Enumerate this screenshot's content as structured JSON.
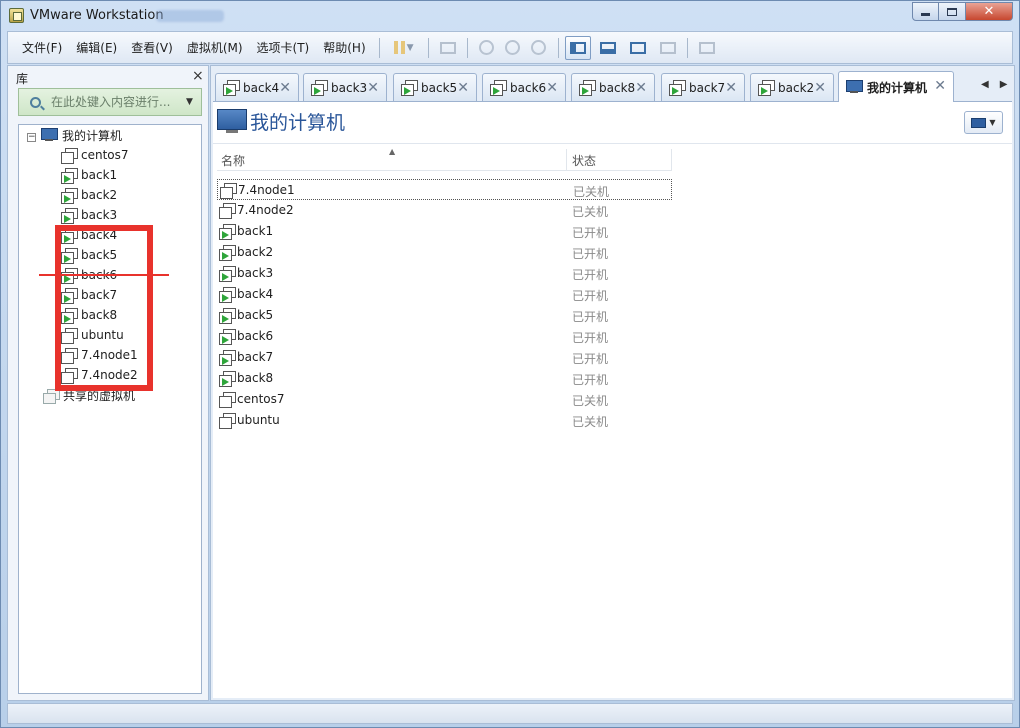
{
  "window": {
    "title": "VMware Workstation"
  },
  "menu": [
    {
      "id": "file",
      "label": "文件(F)"
    },
    {
      "id": "edit",
      "label": "编辑(E)"
    },
    {
      "id": "view",
      "label": "查看(V)"
    },
    {
      "id": "vm",
      "label": "虚拟机(M)"
    },
    {
      "id": "tabs",
      "label": "选项卡(T)"
    },
    {
      "id": "help",
      "label": "帮助(H)"
    }
  ],
  "library": {
    "title": "库",
    "search_placeholder": "在此处键入内容进行...",
    "root": "我的计算机",
    "items": [
      "centos7",
      "back1",
      "back2",
      "back3",
      "back4",
      "back5",
      "back6",
      "back7",
      "back8",
      "ubuntu",
      "7.4node1",
      "7.4node2"
    ],
    "shared": "共享的虚拟机"
  },
  "tabs": [
    {
      "label": "back4",
      "active": false
    },
    {
      "label": "back3",
      "active": false
    },
    {
      "label": "back5",
      "active": false
    },
    {
      "label": "back6",
      "active": false
    },
    {
      "label": "back8",
      "active": false
    },
    {
      "label": "back7",
      "active": false
    },
    {
      "label": "back2",
      "active": false
    },
    {
      "label": "我的计算机",
      "active": true
    }
  ],
  "main": {
    "title": "我的计算机",
    "columns": {
      "name": "名称",
      "status": "状态"
    },
    "rows": [
      {
        "name": "7.4node1",
        "status": "已关机",
        "running": false
      },
      {
        "name": "7.4node2",
        "status": "已关机",
        "running": false
      },
      {
        "name": "back1",
        "status": "已开机",
        "running": true
      },
      {
        "name": "back2",
        "status": "已开机",
        "running": true
      },
      {
        "name": "back3",
        "status": "已开机",
        "running": true
      },
      {
        "name": "back4",
        "status": "已开机",
        "running": true
      },
      {
        "name": "back5",
        "status": "已开机",
        "running": true
      },
      {
        "name": "back6",
        "status": "已开机",
        "running": true
      },
      {
        "name": "back7",
        "status": "已开机",
        "running": true
      },
      {
        "name": "back8",
        "status": "已开机",
        "running": true
      },
      {
        "name": "centos7",
        "status": "已关机",
        "running": false
      },
      {
        "name": "ubuntu",
        "status": "已关机",
        "running": false
      }
    ]
  },
  "colors": {
    "accent": "#2a5699",
    "annotation": "#e8322c",
    "running": "#2ea53a"
  },
  "icons": [
    "app-icon",
    "minimize-icon",
    "maximize-icon",
    "close-icon",
    "search-icon",
    "computer-icon",
    "vm-icon",
    "vm-running-icon",
    "shared-vm-icon",
    "pause-icon",
    "snapshot-icon",
    "fullscreen-icon",
    "unity-icon"
  ]
}
